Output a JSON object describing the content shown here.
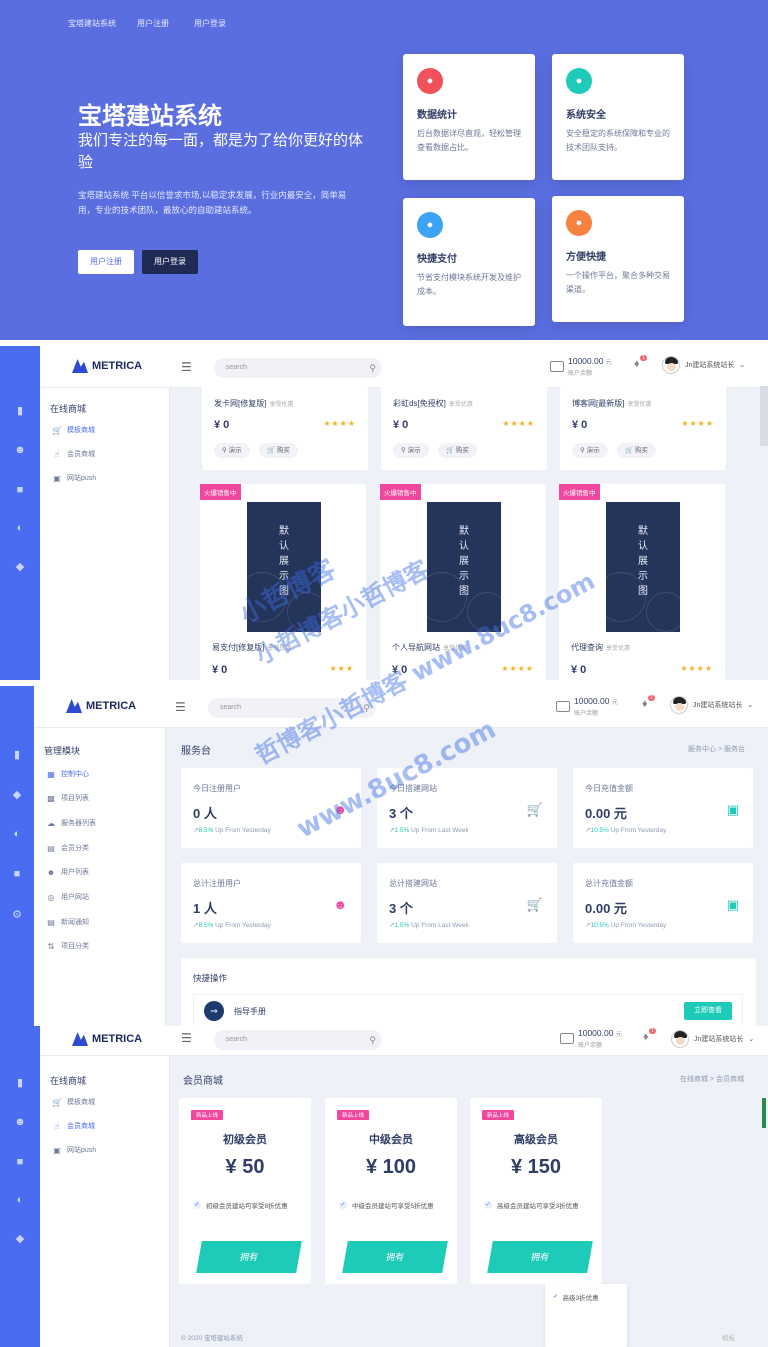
{
  "hero": {
    "nav": [
      "宝塔建站系统",
      "用户注册",
      "用户登录"
    ],
    "title": "宝塔建站系统",
    "subtitle": "我们专注的每一面，都是为了给你更好的体验",
    "desc": "宝塔建站系统 平台以信誉求市场,以稳定求发展，行业内最安全，简单易用，专业的技术团队，最放心的自助建站系统。",
    "btn_register": "用户注册",
    "btn_login": "用户登录",
    "features": [
      {
        "title": "数据统计",
        "desc": "后台数据详尽直观，轻松管理查看数据占比。",
        "color": "#f1515b",
        "icon": "thumb-icon"
      },
      {
        "title": "系统安全",
        "desc": "安全稳定的系统保障和专业的技术团队支持。",
        "color": "#1ecab8",
        "icon": "thumb-icon"
      },
      {
        "title": "快捷支付",
        "desc": "节省支付模块系统开发及维护成本。",
        "color": "#3da4f5",
        "icon": "thumb-icon"
      },
      {
        "title": "方便快捷",
        "desc": "一个操作平台，聚合多种交易渠道。",
        "color": "#f7813e",
        "icon": "thumb-icon"
      }
    ]
  },
  "header": {
    "logo": "METRICA",
    "search_placeholder": "search",
    "balance": "10000.00",
    "balance_unit": "元",
    "balance_label": "账户余额",
    "username": "Jn建站系统站长",
    "username_p3": "Jn建站系统站长",
    "notif_count": "1"
  },
  "shop_side": {
    "heading": "在线商城",
    "items": [
      "模板商城",
      "会员商城",
      "网站push"
    ]
  },
  "products": {
    "row1": [
      {
        "name": "发卡网[修复版]",
        "tag": "享受优惠",
        "price": "¥ 0",
        "stars": "★★★★"
      },
      {
        "name": "彩虹ds[免授权]",
        "tag": "享受优惠",
        "price": "¥ 0",
        "stars": "★★★★"
      },
      {
        "name": "博客网[最新版]",
        "tag": "享受优惠",
        "price": "¥ 0",
        "stars": "★★★★"
      }
    ],
    "demo": "演示",
    "buy": "购买",
    "hot": "火爆销售中",
    "poster_text": "默认展示图",
    "row2": [
      {
        "name": "易支付[修复版]",
        "tag": "享受优惠",
        "price": "¥ 0",
        "stars": "★★★"
      },
      {
        "name": "个人导航网站",
        "tag": "享受优惠",
        "price": "¥ 0",
        "stars": "★★★★"
      },
      {
        "name": "代理查询",
        "tag": "享受优惠",
        "price": "¥ 0",
        "stars": "★★★★"
      }
    ]
  },
  "admin_side": {
    "heading": "管理模块",
    "items": [
      "控制中心",
      "项目列表",
      "服务器列表",
      "会员分类",
      "用户列表",
      "用户网站",
      "新闻通知",
      "项目分类"
    ]
  },
  "dashboard": {
    "title": "服务台",
    "breadcrumb": [
      "服务中心",
      ">",
      "服务台"
    ],
    "stats": [
      {
        "label": "今日注册用户",
        "value": "0 人",
        "pct": "8.5%",
        "sub": "Up From Yesterday",
        "color": "#f1469e",
        "icon": "users-icon"
      },
      {
        "label": "今日搭建网站",
        "value": "3 个",
        "pct": "1.5%",
        "sub": "Up From Last Week",
        "color": "#1ecab8",
        "icon": "cart-icon"
      },
      {
        "label": "今日充值金额",
        "value": "0.00 元",
        "pct": "10.5%",
        "sub": "Up From Yesterday",
        "color": "#1ecab8",
        "icon": "wallet-icon"
      },
      {
        "label": "总计注册用户",
        "value": "1 人",
        "pct": "8.5%",
        "sub": "Up From Yesterday",
        "color": "#f1469e",
        "icon": "users-icon"
      },
      {
        "label": "总计搭建网站",
        "value": "3 个",
        "pct": "1.5%",
        "sub": "Up From Last Week",
        "color": "#1ecab8",
        "icon": "cart-icon"
      },
      {
        "label": "总计充值金额",
        "value": "0.00 元",
        "pct": "10.5%",
        "sub": "Up From Yesterday",
        "color": "#1ecab8",
        "icon": "wallet-icon"
      }
    ],
    "quick_title": "快捷操作",
    "guide": "指导手册",
    "view_now": "立即查看"
  },
  "membership": {
    "title": "会员商城",
    "breadcrumb": [
      "在线商城",
      ">",
      "会员商城"
    ],
    "new_tag": "新品上线",
    "own": "拥有",
    "plans": [
      {
        "name": "初级会员",
        "price": "¥ 50",
        "feature": "初级会员建站可享受8折优惠"
      },
      {
        "name": "中级会员",
        "price": "¥ 100",
        "feature": "中级会员建站可享受5折优惠"
      },
      {
        "name": "高级会员",
        "price": "¥ 150",
        "feature": "高级会员建站可享受3折优惠"
      }
    ],
    "tooltip": "高级3折优惠",
    "footer": "© 2020 宝塔建站系统",
    "footer_right": "模板"
  },
  "watermark": {
    "line1": "小哲博客",
    "line2": "小哲博客小哲博客",
    "line3": "哲博客小哲博客 www.8uc8.com",
    "line4": "www.8uc8.com"
  },
  "colors": {
    "primary": "#4a6cf0",
    "hero": "#5a6ee0",
    "teal": "#1ecab8",
    "pink": "#f1469e"
  }
}
